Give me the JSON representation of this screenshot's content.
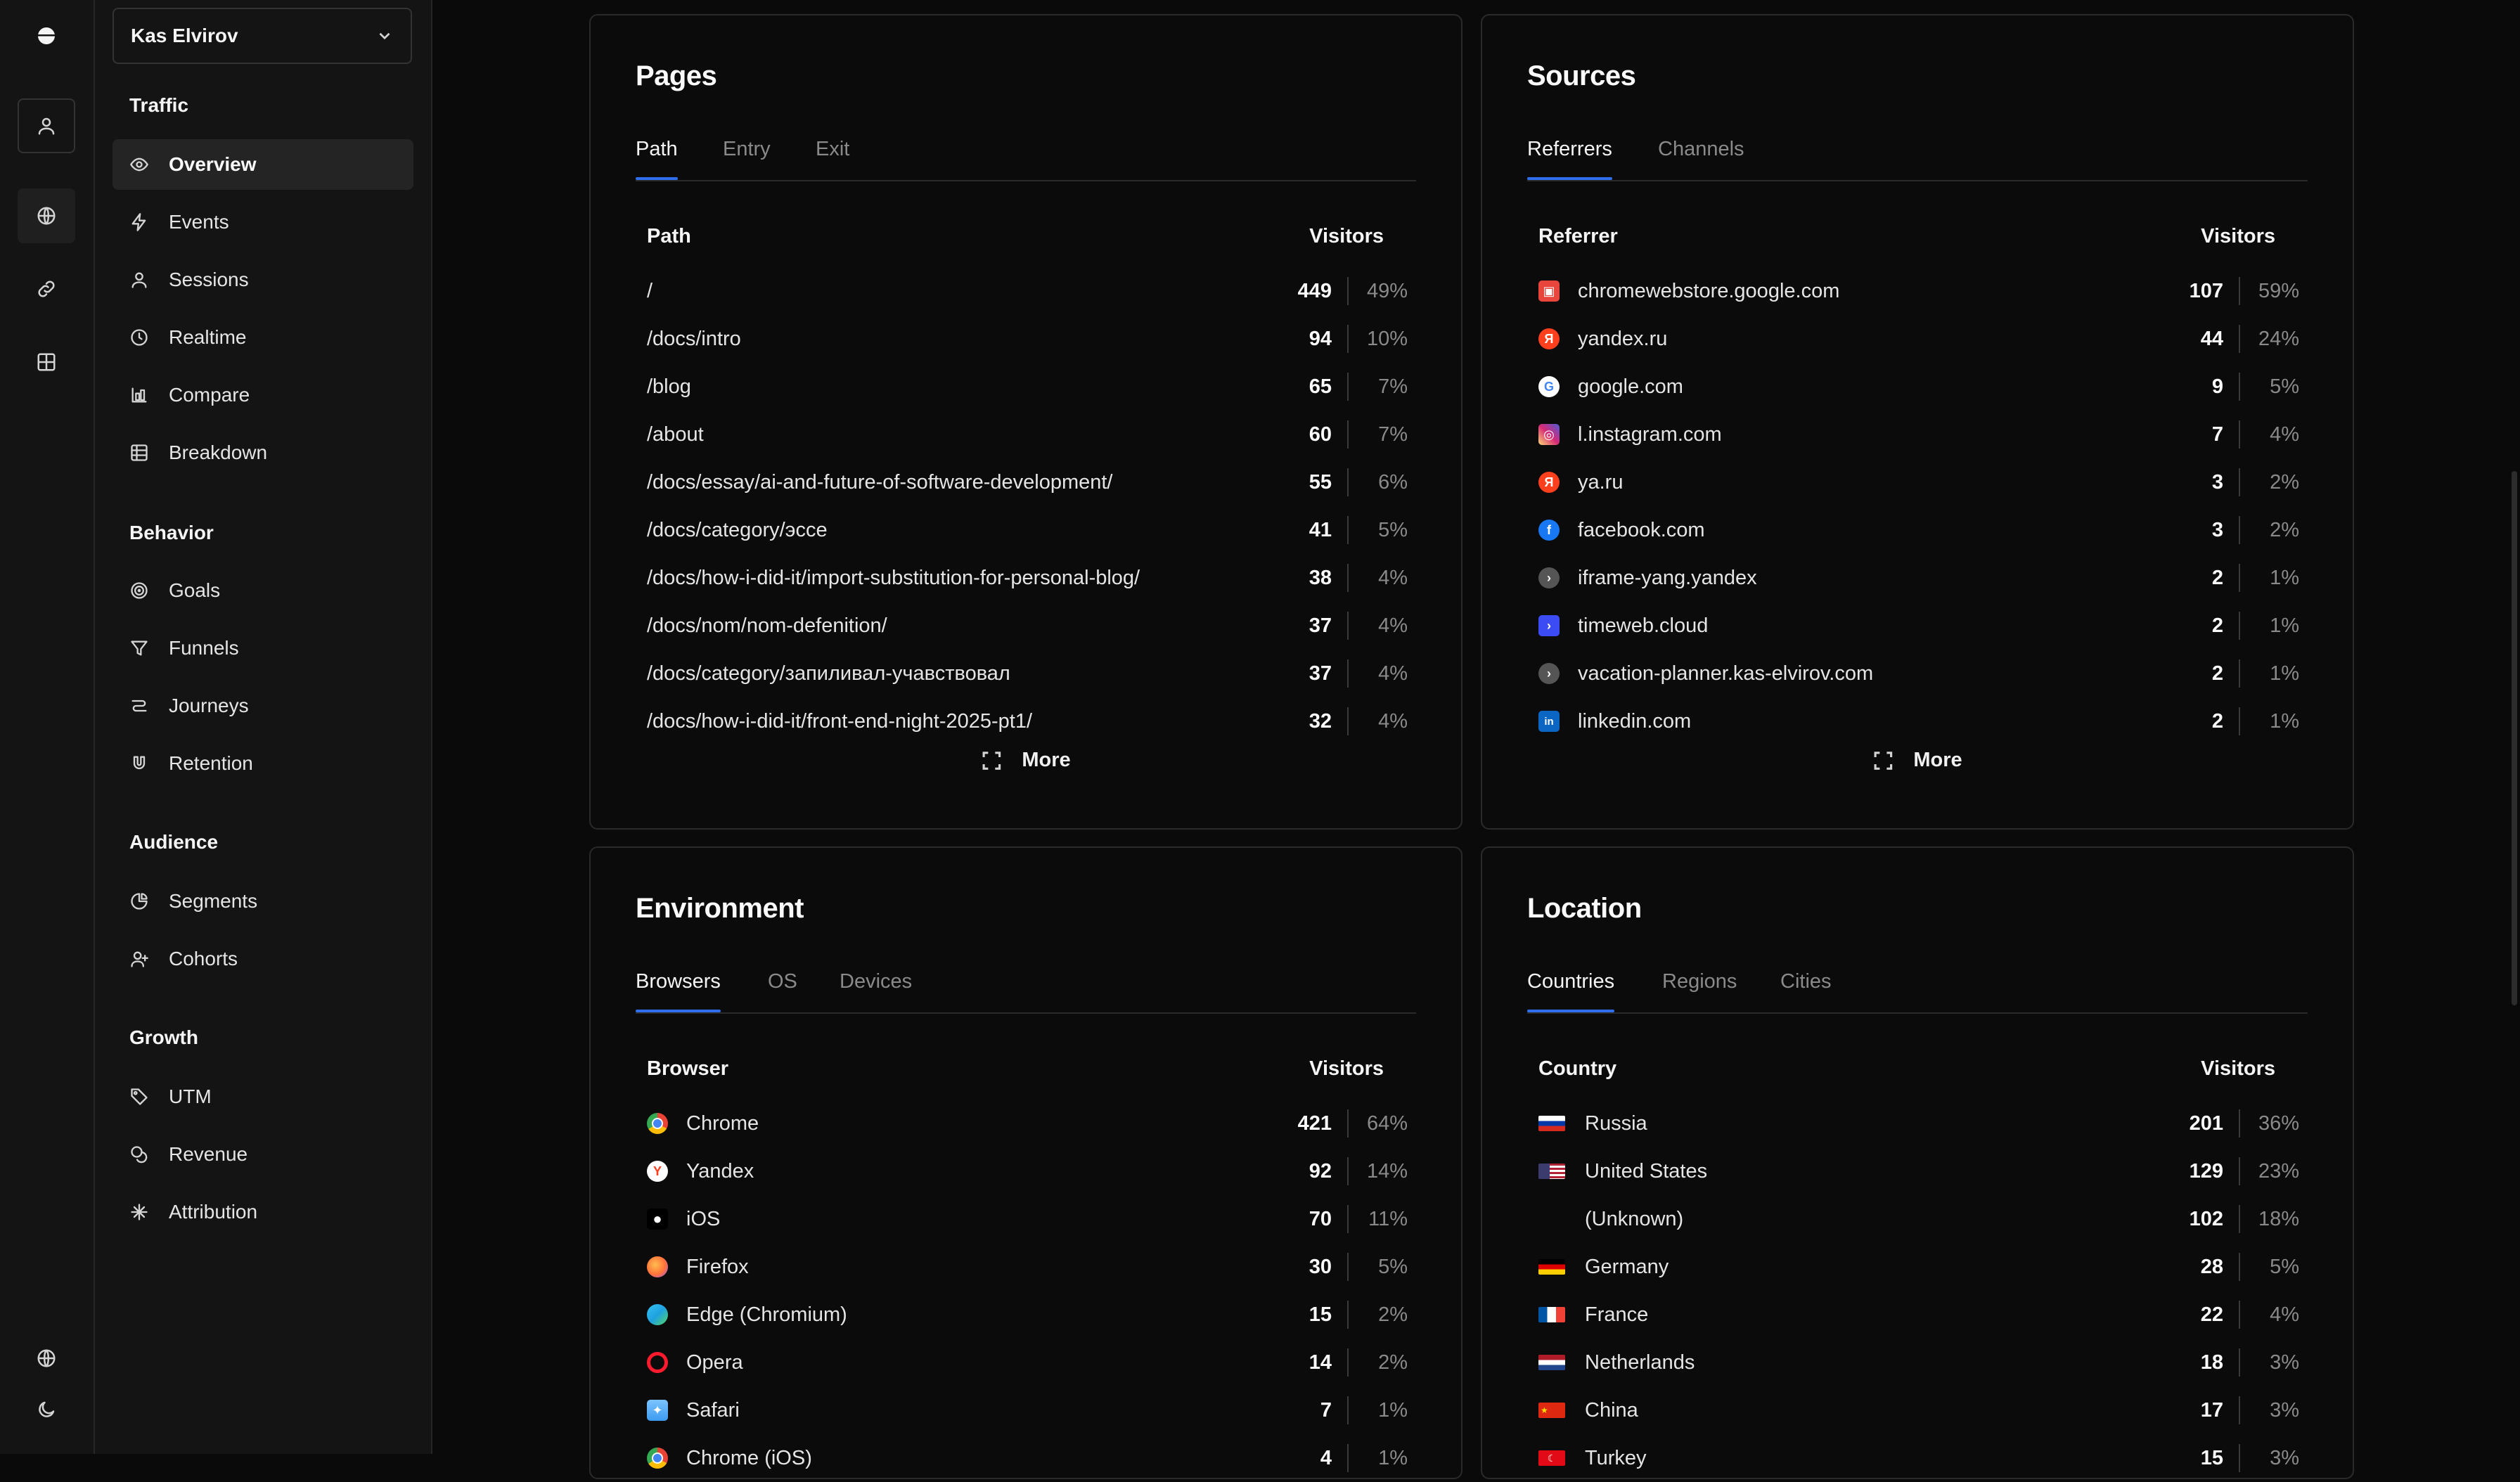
{
  "site": {
    "name": "Kas Elvirov"
  },
  "sidebar": {
    "groups": [
      {
        "title": "Traffic",
        "items": [
          {
            "label": "Overview",
            "icon": "eye-icon"
          },
          {
            "label": "Events",
            "icon": "lightning-icon"
          },
          {
            "label": "Sessions",
            "icon": "user-icon"
          },
          {
            "label": "Realtime",
            "icon": "clock-icon"
          },
          {
            "label": "Compare",
            "icon": "compare-icon"
          },
          {
            "label": "Breakdown",
            "icon": "table-icon"
          }
        ]
      },
      {
        "title": "Behavior",
        "items": [
          {
            "label": "Goals",
            "icon": "target-icon"
          },
          {
            "label": "Funnels",
            "icon": "funnel-icon"
          },
          {
            "label": "Journeys",
            "icon": "route-icon"
          },
          {
            "label": "Retention",
            "icon": "magnet-icon"
          }
        ]
      },
      {
        "title": "Audience",
        "items": [
          {
            "label": "Segments",
            "icon": "pie-icon"
          },
          {
            "label": "Cohorts",
            "icon": "user-plus-icon"
          }
        ]
      },
      {
        "title": "Growth",
        "items": [
          {
            "label": "UTM",
            "icon": "tag-icon"
          },
          {
            "label": "Revenue",
            "icon": "coins-icon"
          },
          {
            "label": "Attribution",
            "icon": "network-icon"
          }
        ]
      }
    ]
  },
  "pages": {
    "title": "Pages",
    "tabs": [
      "Path",
      "Entry",
      "Exit"
    ],
    "col_left": "Path",
    "col_right": "Visitors",
    "rows": [
      {
        "name": "/",
        "value": "449",
        "pct": "49%"
      },
      {
        "name": "/docs/intro",
        "value": "94",
        "pct": "10%"
      },
      {
        "name": "/blog",
        "value": "65",
        "pct": "7%"
      },
      {
        "name": "/about",
        "value": "60",
        "pct": "7%"
      },
      {
        "name": "/docs/essay/ai-and-future-of-software-development/",
        "value": "55",
        "pct": "6%"
      },
      {
        "name": "/docs/category/эссе",
        "value": "41",
        "pct": "5%"
      },
      {
        "name": "/docs/how-i-did-it/import-substitution-for-personal-blog/",
        "value": "38",
        "pct": "4%"
      },
      {
        "name": "/docs/nom/nom-defenition/",
        "value": "37",
        "pct": "4%"
      },
      {
        "name": "/docs/category/запиливал-учавствовал",
        "value": "37",
        "pct": "4%"
      },
      {
        "name": "/docs/how-i-did-it/front-end-night-2025-pt1/",
        "value": "32",
        "pct": "4%"
      }
    ],
    "more": "More"
  },
  "sources": {
    "title": "Sources",
    "tabs": [
      "Referrers",
      "Channels"
    ],
    "col_left": "Referrer",
    "col_right": "Visitors",
    "rows": [
      {
        "name": "chromewebstore.google.com",
        "value": "107",
        "pct": "59%",
        "icon": "chromewebstore-icon",
        "color": "#e8453c"
      },
      {
        "name": "yandex.ru",
        "value": "44",
        "pct": "24%",
        "icon": "yandex-icon",
        "color": "#fc3f1d"
      },
      {
        "name": "google.com",
        "value": "9",
        "pct": "5%",
        "icon": "google-icon",
        "color": "#4285f4"
      },
      {
        "name": "l.instagram.com",
        "value": "7",
        "pct": "4%",
        "icon": "instagram-icon",
        "color": "#d62976"
      },
      {
        "name": "ya.ru",
        "value": "3",
        "pct": "2%",
        "icon": "yandex-icon",
        "color": "#fc3f1d"
      },
      {
        "name": "facebook.com",
        "value": "3",
        "pct": "2%",
        "icon": "facebook-icon",
        "color": "#1877f2"
      },
      {
        "name": "iframe-yang.yandex",
        "value": "2",
        "pct": "1%",
        "icon": "generic-site-icon",
        "color": "#555555"
      },
      {
        "name": "timeweb.cloud",
        "value": "2",
        "pct": "1%",
        "icon": "timeweb-icon",
        "color": "#3b4cf5"
      },
      {
        "name": "vacation-planner.kas-elvirov.com",
        "value": "2",
        "pct": "1%",
        "icon": "generic-site-icon",
        "color": "#555555"
      },
      {
        "name": "linkedin.com",
        "value": "2",
        "pct": "1%",
        "icon": "linkedin-icon",
        "color": "#0a66c2"
      }
    ],
    "more": "More"
  },
  "environment": {
    "title": "Environment",
    "tabs": [
      "Browsers",
      "OS",
      "Devices"
    ],
    "col_left": "Browser",
    "col_right": "Visitors",
    "rows": [
      {
        "name": "Chrome",
        "value": "421",
        "pct": "64%",
        "icon": "chrome-icon",
        "color": "#4285f4"
      },
      {
        "name": "Yandex",
        "value": "92",
        "pct": "14%",
        "icon": "yandex-browser-icon",
        "color": "#fc3f1d"
      },
      {
        "name": "iOS",
        "value": "70",
        "pct": "11%",
        "icon": "apple-icon",
        "color": "#000000"
      },
      {
        "name": "Firefox",
        "value": "30",
        "pct": "5%",
        "icon": "firefox-icon",
        "color": "#ff7139"
      },
      {
        "name": "Edge (Chromium)",
        "value": "15",
        "pct": "2%",
        "icon": "edge-icon",
        "color": "#1fa1e0"
      },
      {
        "name": "Opera",
        "value": "14",
        "pct": "2%",
        "icon": "opera-icon",
        "color": "#ff1b2d"
      },
      {
        "name": "Safari",
        "value": "7",
        "pct": "1%",
        "icon": "safari-icon",
        "color": "#3d9bf0"
      },
      {
        "name": "Chrome (iOS)",
        "value": "4",
        "pct": "1%",
        "icon": "chrome-icon",
        "color": "#4285f4"
      }
    ]
  },
  "location": {
    "title": "Location",
    "tabs": [
      "Countries",
      "Regions",
      "Cities"
    ],
    "col_left": "Country",
    "col_right": "Visitors",
    "rows": [
      {
        "name": "Russia",
        "value": "201",
        "pct": "36%",
        "icon": "flag-russia-icon"
      },
      {
        "name": "United States",
        "value": "129",
        "pct": "23%",
        "icon": "flag-us-icon"
      },
      {
        "name": "(Unknown)",
        "value": "102",
        "pct": "18%",
        "icon": ""
      },
      {
        "name": "Germany",
        "value": "28",
        "pct": "5%",
        "icon": "flag-germany-icon"
      },
      {
        "name": "France",
        "value": "22",
        "pct": "4%",
        "icon": "flag-france-icon"
      },
      {
        "name": "Netherlands",
        "value": "18",
        "pct": "3%",
        "icon": "flag-netherlands-icon"
      },
      {
        "name": "China",
        "value": "17",
        "pct": "3%",
        "icon": "flag-china-icon"
      },
      {
        "name": "Turkey",
        "value": "15",
        "pct": "3%",
        "icon": "flag-turkey-icon"
      }
    ]
  },
  "colors": {
    "accent": "#2f6fed",
    "background": "#0a0a0a",
    "sidebar": "#141414",
    "border": "#2a2a2a"
  }
}
